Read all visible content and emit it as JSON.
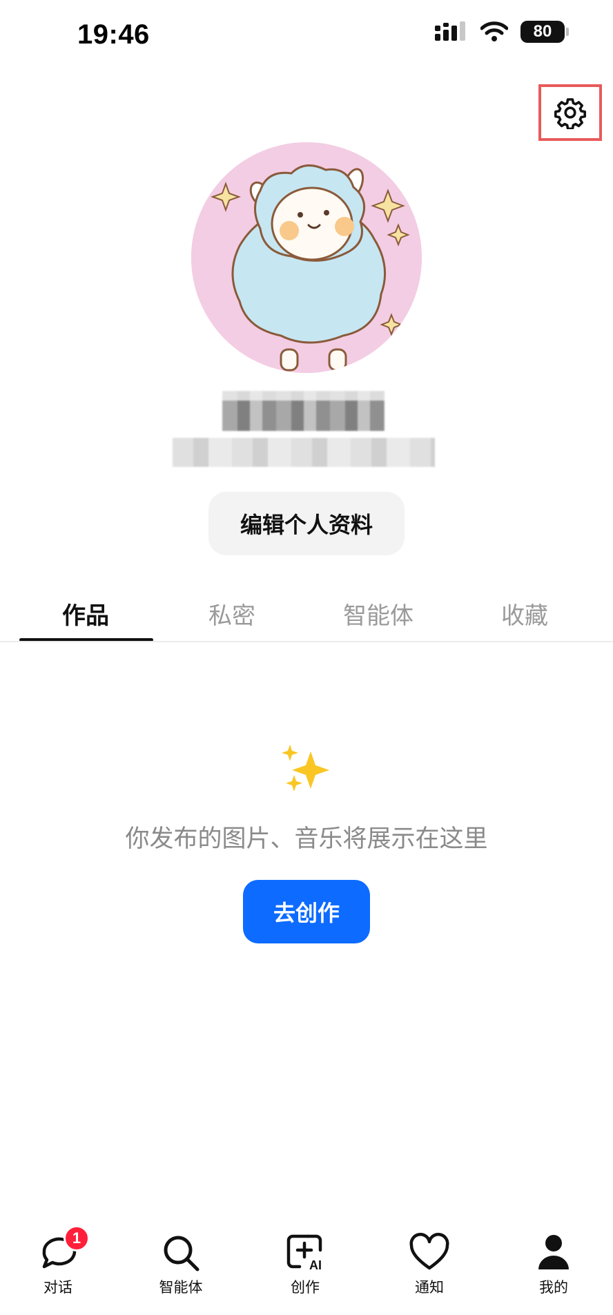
{
  "status_bar": {
    "time": "19:46",
    "battery": "80"
  },
  "profile": {
    "edit_button_label": "编辑个人资料"
  },
  "tabs": [
    {
      "label": "作品",
      "active": true
    },
    {
      "label": "私密",
      "active": false
    },
    {
      "label": "智能体",
      "active": false
    },
    {
      "label": "收藏",
      "active": false
    }
  ],
  "empty_state": {
    "icon": "sparkles-icon",
    "message": "你发布的图片、音乐将展示在这里",
    "create_button_label": "去创作"
  },
  "bottom_nav": [
    {
      "label": "对话",
      "icon": "chat-icon",
      "badge": "1"
    },
    {
      "label": "智能体",
      "icon": "search-icon"
    },
    {
      "label": "创作",
      "icon": "create-ai-icon"
    },
    {
      "label": "通知",
      "icon": "heart-icon"
    },
    {
      "label": "我的",
      "icon": "person-icon",
      "active": true
    }
  ],
  "colors": {
    "accent": "#0d6bff",
    "badge": "#ff1f3a",
    "settings_highlight": "#e85a5a"
  }
}
